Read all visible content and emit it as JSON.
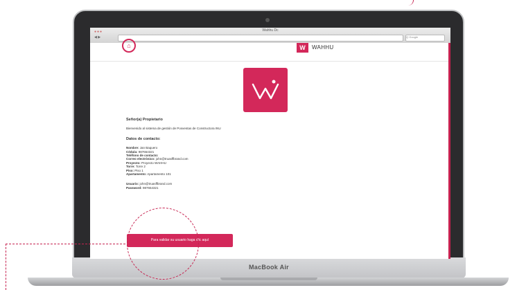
{
  "laptop": {
    "brand": "MacBook Air"
  },
  "browser": {
    "window_title": "Wahhu Dc",
    "search_placeholder": "Q Google"
  },
  "header": {
    "logo_glyph": "W",
    "brand": "WAHHU"
  },
  "email": {
    "greeting": "Señor(a) Propietario",
    "intro": "Bienvenido al sistema de gestión de Posventas de Constructora INU",
    "contact_heading": "Datos de contacto:",
    "fields": [
      {
        "label": "Nombre:",
        "value": "Jan Baquero"
      },
      {
        "label": "Cédula:",
        "value": "987654321"
      },
      {
        "label": "Teléfono de contacto:",
        "value": ""
      },
      {
        "label": "Correo electrónico:",
        "value": "john@truasffbrand.com"
      },
      {
        "label": "Proyecto:",
        "value": "Proyecto WAHHU"
      },
      {
        "label": "Torre:",
        "value": "Torre 2"
      },
      {
        "label": "Piso:",
        "value": "Piso 1"
      },
      {
        "label": "Apartamento:",
        "value": "Apartamento 101"
      }
    ],
    "credentials": [
      {
        "label": "Usuario:",
        "value": "john@truasffbrand.com"
      },
      {
        "label": "Password:",
        "value": "987654321"
      }
    ],
    "cta_label": "Para validar su usuario haga clic aquí"
  },
  "colors": {
    "accent": "#d3285a"
  },
  "icons": [
    "home-icon",
    "wahhu-logo-icon"
  ]
}
